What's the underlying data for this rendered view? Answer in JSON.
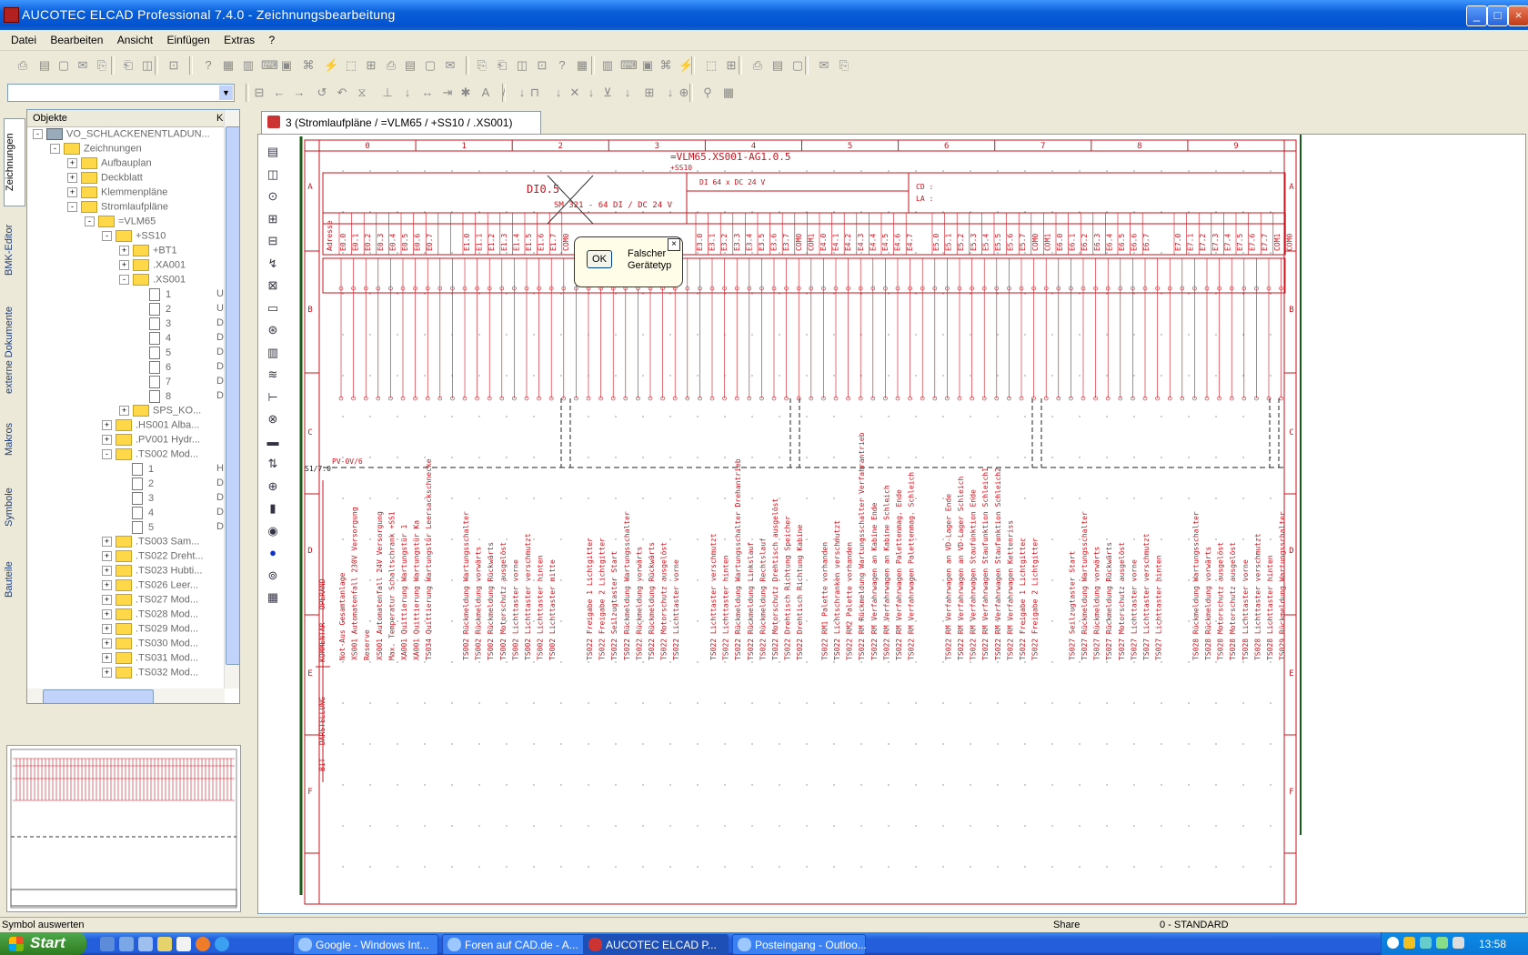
{
  "window": {
    "title": "AUCOTEC     ELCAD Professional 7.4.0 - Zeichnungsbearbeitung",
    "controls": {
      "minimize": "_",
      "maximize": "□",
      "close": "×"
    }
  },
  "menu": [
    "Datei",
    "Bearbeiten",
    "Ansicht",
    "Einfügen",
    "Extras",
    "?"
  ],
  "objects_panel": {
    "header_col1": "Objekte",
    "header_col2": "Ke",
    "tree": [
      {
        "label": "VO_SCHLACKENENTLADUN...",
        "level": 0,
        "type": "root",
        "exp": "-"
      },
      {
        "label": "Zeichnungen",
        "level": 1,
        "type": "folder",
        "exp": "-"
      },
      {
        "label": "Aufbauplan",
        "level": 2,
        "type": "folder",
        "exp": "+"
      },
      {
        "label": "Deckblatt",
        "level": 2,
        "type": "folder",
        "exp": "+"
      },
      {
        "label": "Klemmenpläne",
        "level": 2,
        "type": "folder",
        "exp": "+"
      },
      {
        "label": "Stromlaufpläne",
        "level": 2,
        "type": "folder",
        "exp": "-"
      },
      {
        "label": "=VLM65",
        "level": 3,
        "type": "folder",
        "exp": "-"
      },
      {
        "label": "+SS10",
        "level": 4,
        "type": "folder",
        "exp": "-"
      },
      {
        "label": "+BT1",
        "level": 5,
        "type": "folder",
        "exp": "+"
      },
      {
        "label": ".XA001",
        "level": 5,
        "type": "folder",
        "exp": "+"
      },
      {
        "label": ".XS001",
        "level": 5,
        "type": "folder",
        "exp": "-"
      },
      {
        "label": "1",
        "level": 6,
        "type": "page",
        "k": "U"
      },
      {
        "label": "2",
        "level": 6,
        "type": "page",
        "k": "U"
      },
      {
        "label": "3",
        "level": 6,
        "type": "page",
        "k": "D"
      },
      {
        "label": "4",
        "level": 6,
        "type": "page",
        "k": "D"
      },
      {
        "label": "5",
        "level": 6,
        "type": "page",
        "k": "D"
      },
      {
        "label": "6",
        "level": 6,
        "type": "page",
        "k": "D"
      },
      {
        "label": "7",
        "level": 6,
        "type": "page",
        "k": "D"
      },
      {
        "label": "8",
        "level": 6,
        "type": "page",
        "k": "D"
      },
      {
        "label": "SPS_KO...",
        "level": 5,
        "type": "folder",
        "exp": "+"
      },
      {
        "label": ".HS001 Alba...",
        "level": 4,
        "type": "folder",
        "exp": "+"
      },
      {
        "label": ".PV001 Hydr...",
        "level": 4,
        "type": "folder",
        "exp": "+"
      },
      {
        "label": ".TS002 Mod...",
        "level": 4,
        "type": "folder",
        "exp": "-"
      },
      {
        "label": "1",
        "level": 5,
        "type": "page",
        "k": "H"
      },
      {
        "label": "2",
        "level": 5,
        "type": "page",
        "k": "D"
      },
      {
        "label": "3",
        "level": 5,
        "type": "page",
        "k": "D"
      },
      {
        "label": "4",
        "level": 5,
        "type": "page",
        "k": "D"
      },
      {
        "label": "5",
        "level": 5,
        "type": "page",
        "k": "D"
      },
      {
        "label": ".TS003 Sam...",
        "level": 4,
        "type": "folder",
        "exp": "+"
      },
      {
        "label": ".TS022 Dreht...",
        "level": 4,
        "type": "folder",
        "exp": "+"
      },
      {
        "label": ".TS023 Hubti...",
        "level": 4,
        "type": "folder",
        "exp": "+"
      },
      {
        "label": ".TS026 Leer...",
        "level": 4,
        "type": "folder",
        "exp": "+"
      },
      {
        "label": ".TS027 Mod...",
        "level": 4,
        "type": "folder",
        "exp": "+"
      },
      {
        "label": ".TS028 Mod...",
        "level": 4,
        "type": "folder",
        "exp": "+"
      },
      {
        "label": ".TS029 Mod...",
        "level": 4,
        "type": "folder",
        "exp": "+"
      },
      {
        "label": ".TS030 Mod...",
        "level": 4,
        "type": "folder",
        "exp": "+"
      },
      {
        "label": ".TS031 Mod...",
        "level": 4,
        "type": "folder",
        "exp": "+"
      },
      {
        "label": ".TS032 Mod...",
        "level": 4,
        "type": "folder",
        "exp": "+"
      }
    ]
  },
  "side_tabs": [
    "Zeichnungen",
    "BMK-Editor",
    "externe Dokumente",
    "Makros",
    "Symbole",
    "Bauteile"
  ],
  "document": {
    "tab_title": "3 (Stromlaufpläne / =VLM65 / +SS10 / .XS001)",
    "drawing": {
      "title": "=VLM65.XS001-AG1.0.5",
      "subtitle": "+SS10",
      "module1_name": "DI0.5",
      "module1_desc": "SM 321 - 64 DI / DC 24 V",
      "module2_desc": "DI 64 x DC 24 V",
      "cd_label": "CD :",
      "la_label": "LA :",
      "adresse": "Adresse",
      "kommentar": "KOMMENTAR - OPERAND",
      "bit_darstellung": "BIT - DARSTELLUNG",
      "pv_label": "PV-0V/6",
      "ref_label": "S1/7.0",
      "columns": [
        "0",
        "1",
        "2",
        "3",
        "4",
        "5",
        "6",
        "7",
        "8",
        "9"
      ],
      "rows": [
        "A",
        "B",
        "C",
        "D",
        "E",
        "F"
      ],
      "addr_g1": [
        "E0.0",
        "E0.1",
        "E0.2",
        "E0.3",
        "E0.4",
        "E0.5",
        "E0.6",
        "E0.7",
        "",
        "",
        "E1.0",
        "E1.1",
        "E1.2",
        "E1.3",
        "E1.4",
        "E1.5",
        "E1.6",
        "E1.7",
        "COM0"
      ],
      "addr_g2": [
        "E3.0",
        "E3.1",
        "E3.2",
        "E3.3",
        "E3.4",
        "E3.5",
        "E3.6",
        "E3.7",
        "COM0",
        "COM1",
        "E4.0",
        "E4.1",
        "E4.2",
        "E4.3",
        "E4.4",
        "E4.5",
        "E4.6",
        "E4.7"
      ],
      "addr_g3": [
        "E5.0",
        "E5.1",
        "E5.2",
        "E5.3",
        "E5.4",
        "E5.5",
        "E5.6",
        "E5.7",
        "COM0",
        "COM1",
        "E6.0",
        "E6.1",
        "E6.2",
        "E6.3",
        "E6.4",
        "E6.5",
        "E6.6",
        "E6.7"
      ],
      "addr_g4": [
        "E7.0",
        "E7.1",
        "E7.2",
        "E7.3",
        "E7.4",
        "E7.5",
        "E7.6",
        "E7.7",
        "COM1",
        "COM0"
      ],
      "comments": [
        "Not-Aus Gesamtanlage",
        "XS001 Automatenfall 230V Versorgung",
        "Reserve",
        "XS001 Automatenfall 24V Versorgung",
        "Max. Temperatur Schaltschrank +SS1",
        "XA001 Quittierung Wartungstür 1",
        "XA001 Quittierung Wartungstür Ka",
        "TS034 Quittierung Wartungstür Leersackschnecke",
        "TS002 Rückmeldung Wartungsschalter",
        "TS002 Rückmeldung vorwärts",
        "TS002 Rückmeldung Rückwärts",
        "TS002 Motorschutz ausgelöst",
        "TS002 Lichttaster vorne",
        "TS002 Lichttaster verschmutzt",
        "TS002 Lichttaster hinten",
        "TS002 Lichttaster mitte",
        "TS022 Freigabe 1 Lichtgitter",
        "TS022 Freigabe 2 Lichtgitter",
        "TS022 Seilzugtaster Start",
        "TS022 Rückmeldung Wartungsschalter",
        "TS022 Rückmeldung vorwärts",
        "TS022 Rückmeldung Rückwärts",
        "TS022 Motorschutz ausgelöst",
        "TS022 Lichttaster vorne",
        "TS022 Lichttaster verschmutzt",
        "TS022 Lichttaster hinten",
        "TS022 Rückmeldung Wartungsschalter Drehantrieb",
        "TS022 Rückmeldung Linkslauf",
        "TS022 Rückmeldung Rechtslauf",
        "TS022 Motorschutz Drehtisch ausgelöst",
        "TS022 Drehtisch Richtung Speicher",
        "TS022 Drehtisch Richtung Kabine",
        "TS022 RM1 Palette vorhanden",
        "TS022 Lichtschranken verschmutzt",
        "TS022 RM2 Palette vorhanden",
        "TS022 RM Rückmeldung Wartungsschalter Verfahrantrieb",
        "TS022 RM Verfahrwagen an Kabine Ende",
        "TS022 RM Verfahrwagen an Kabine Schleich",
        "TS022 RM Verfahrwagen Palettenmag. Ende",
        "TS022 RM Verfahrwagen Palettenmag. Schleich",
        "TS022 RM Verfahrwagen an VD-Lager Ende",
        "TS022 RM Verfahrwagen an VD-Lager Schleich",
        "TS022 RM Verfahrwagen Staufunktion Ende",
        "TS022 RM Verfahrwagen Staufunktion Schleich1",
        "TS022 RM Verfahrwagen Staufunktion Schleich2",
        "TS022 RM Verfahrwagen Kettenriss",
        "TS022 Freigabe 1 Lichtgitter",
        "TS022 Freigabe 2 Lichtgitter",
        "TS027 Seilzugtaster Start",
        "TS027 Rückmeldung Wartungsschalter",
        "TS027 Rückmeldung vorwärts",
        "TS027 Rückmeldung Rückwärts",
        "TS027 Motorschutz ausgelöst",
        "TS027 Lichttaster vorne",
        "TS027 Lichttaster verschmutzt",
        "TS027 Lichttaster hinten",
        "TS028 Rückmeldung Wartungsschalter",
        "TS028 Rückmeldung vorwärts",
        "TS028 Motorschutz ausgelöst",
        "TS028 Motorschutz ausgelöst",
        "TS028 Lichttaster vorne",
        "TS028 Lichttaster verschmutzt",
        "TS028 Lichttaster hinten",
        "TS029 Rückmeldung Wartungsschalter"
      ]
    }
  },
  "dialog": {
    "ok": "OK",
    "message": "Falscher\nGerätetyp",
    "close": "×"
  },
  "statusbar": {
    "left": "Symbol auswerten",
    "mid": "Share",
    "right": "0 - STANDARD"
  },
  "taskbar": {
    "start": "Start",
    "tasks": [
      {
        "label": "Google - Windows Int...",
        "active": false
      },
      {
        "label": "Foren auf CAD.de - A...",
        "active": false
      },
      {
        "label": "AUCOTEC   ELCAD P...",
        "active": true
      },
      {
        "label": "Posteingang - Outloo...",
        "active": false
      }
    ],
    "clock": "13:58"
  },
  "colors": {
    "drawing_red": "#c8141e",
    "titlebar_blue": "#0a5fd8",
    "taskbar_blue": "#245edb",
    "start_green": "#3c8d2f"
  }
}
